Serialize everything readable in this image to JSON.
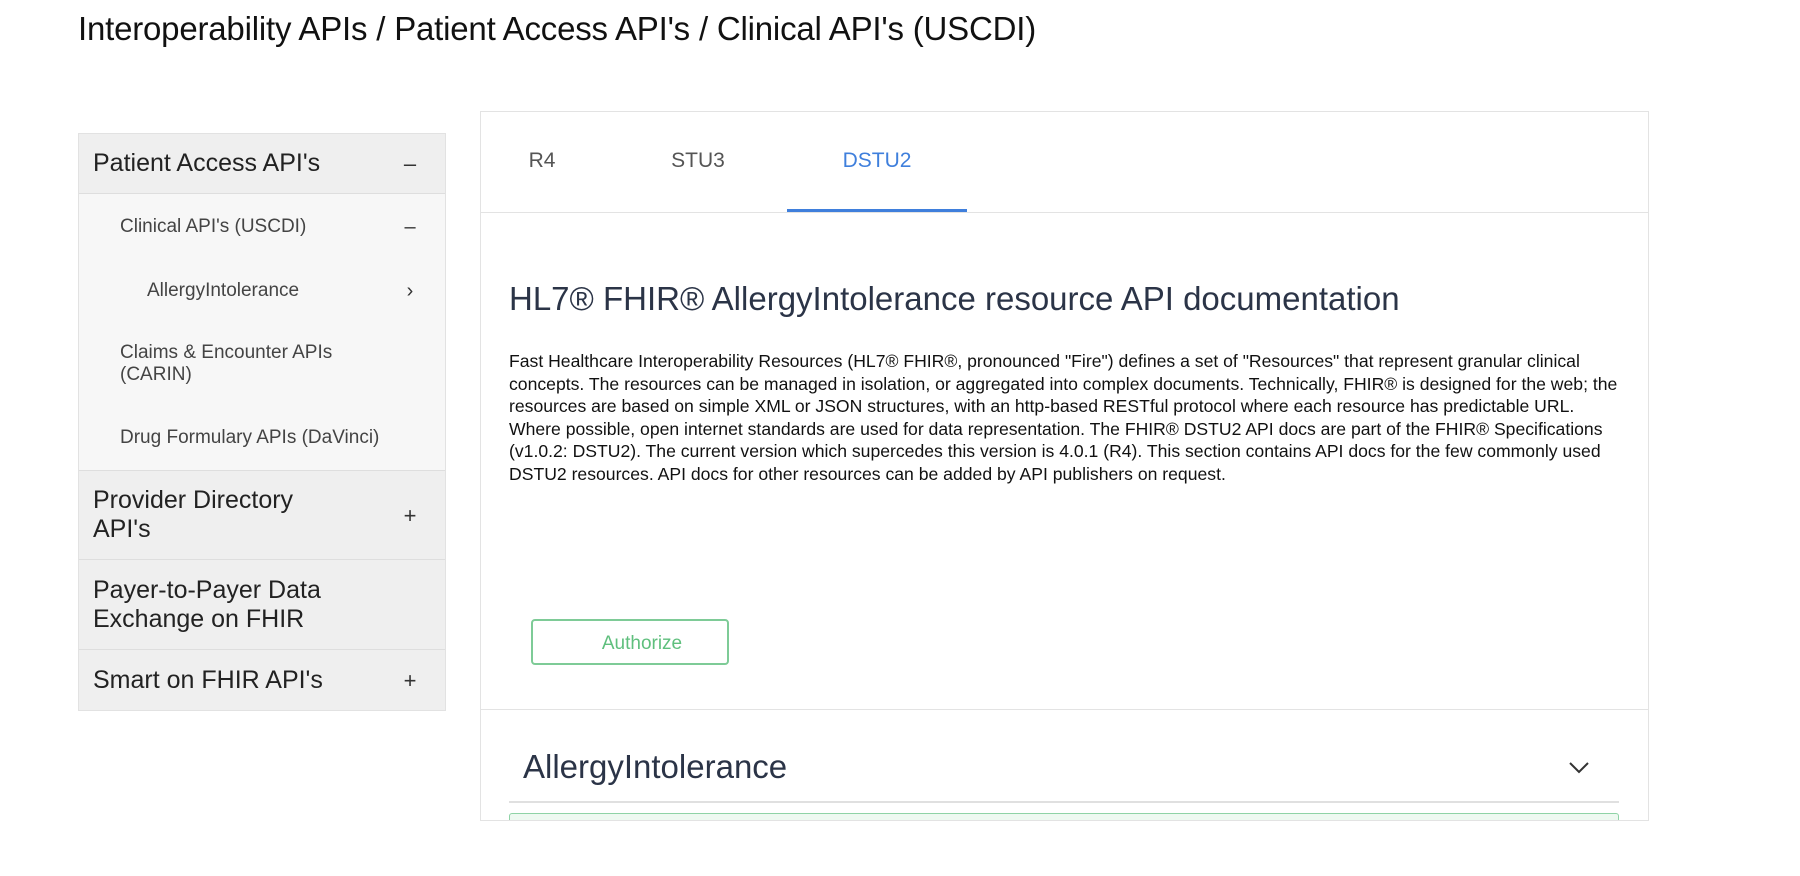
{
  "breadcrumb": "Interoperability APIs / Patient Access API's / Clinical API's (USCDI)",
  "sidebar": {
    "sections": [
      {
        "label": "Patient Access API's",
        "toggle": "–",
        "children": [
          {
            "label": "Clinical API's (USCDI)",
            "toggle": "–"
          },
          {
            "label": "AllergyIntolerance",
            "toggle": "›"
          },
          {
            "label": "Claims & Encounter APIs (CARIN)",
            "toggle": ""
          },
          {
            "label": "Drug Formulary APIs (DaVinci)",
            "toggle": ""
          }
        ]
      },
      {
        "label": "Provider Directory API's",
        "toggle": "+"
      },
      {
        "label": "Payer-to-Payer Data Exchange on FHIR",
        "toggle": ""
      },
      {
        "label": "Smart on FHIR API's",
        "toggle": "+"
      }
    ]
  },
  "tabs": [
    {
      "label": "R4",
      "active": false
    },
    {
      "label": "STU3",
      "active": false
    },
    {
      "label": "DSTU2",
      "active": true
    }
  ],
  "main": {
    "title": "HL7® FHIR® AllergyIntolerance resource API documentation",
    "description": "Fast Healthcare Interoperability Resources (HL7® FHIR®, pronounced \"Fire\") defines a set of \"Resources\" that represent granular clinical concepts. The resources can be managed in isolation, or aggregated into complex documents. Technically, FHIR® is designed for the web; the resources are based on simple XML or JSON structures, with an http-based RESTful protocol where each resource has predictable URL. Where possible, open internet standards are used for data representation. The FHIR® DSTU2 API docs are part of the FHIR® Specifications (v1.0.2: DSTU2). The current version which supercedes this version is 4.0.1 (R4). This section contains API docs for the few commonly used DSTU2 resources. API docs for other resources can be added by API publishers on request.",
    "authorize_label": "Authorize",
    "resource_title": "AllergyIntolerance"
  },
  "colors": {
    "accent": "#3f7fdc",
    "authorize": "#5fbf7d",
    "heading": "#2b3447"
  },
  "icons": {
    "resource_toggle": "chevron-down-icon"
  }
}
